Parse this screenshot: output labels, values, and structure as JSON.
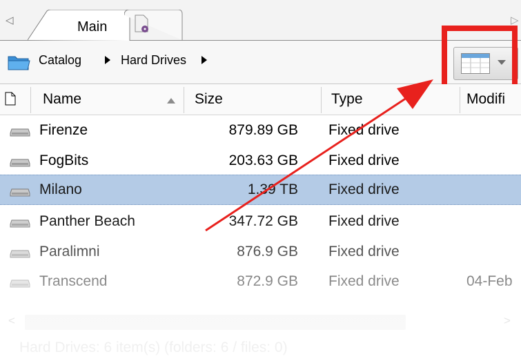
{
  "tabs": [
    {
      "label": "Main",
      "icon": "tab-main"
    },
    {
      "label": "",
      "icon": "document-disc-icon"
    }
  ],
  "breadcrumb": {
    "items": [
      "Catalog",
      "Hard Drives"
    ]
  },
  "columns": [
    "Name",
    "Size",
    "Type",
    "Modifi"
  ],
  "rows": [
    {
      "name": "Firenze",
      "size": "879.89 GB",
      "type": "Fixed drive",
      "modified": ""
    },
    {
      "name": "FogBits",
      "size": "203.63 GB",
      "type": "Fixed drive",
      "modified": ""
    },
    {
      "name": "Milano",
      "size": "1.39 TB",
      "type": "Fixed drive",
      "modified": "",
      "selected": true
    },
    {
      "name": "Panther Beach",
      "size": "347.72 GB",
      "type": "Fixed drive",
      "modified": ""
    },
    {
      "name": "Paralimni",
      "size": "876.9 GB",
      "type": "Fixed drive",
      "modified": ""
    },
    {
      "name": "Transcend",
      "size": "872.9 GB",
      "type": "Fixed drive",
      "modified": "04-Feb"
    }
  ],
  "status": "Hard Drives: 6 item(s) (folders: 6 / files: 0)",
  "colors": {
    "highlight": "#e8211d",
    "selection": "#b4cbe6",
    "arrow": "#e8211d"
  }
}
